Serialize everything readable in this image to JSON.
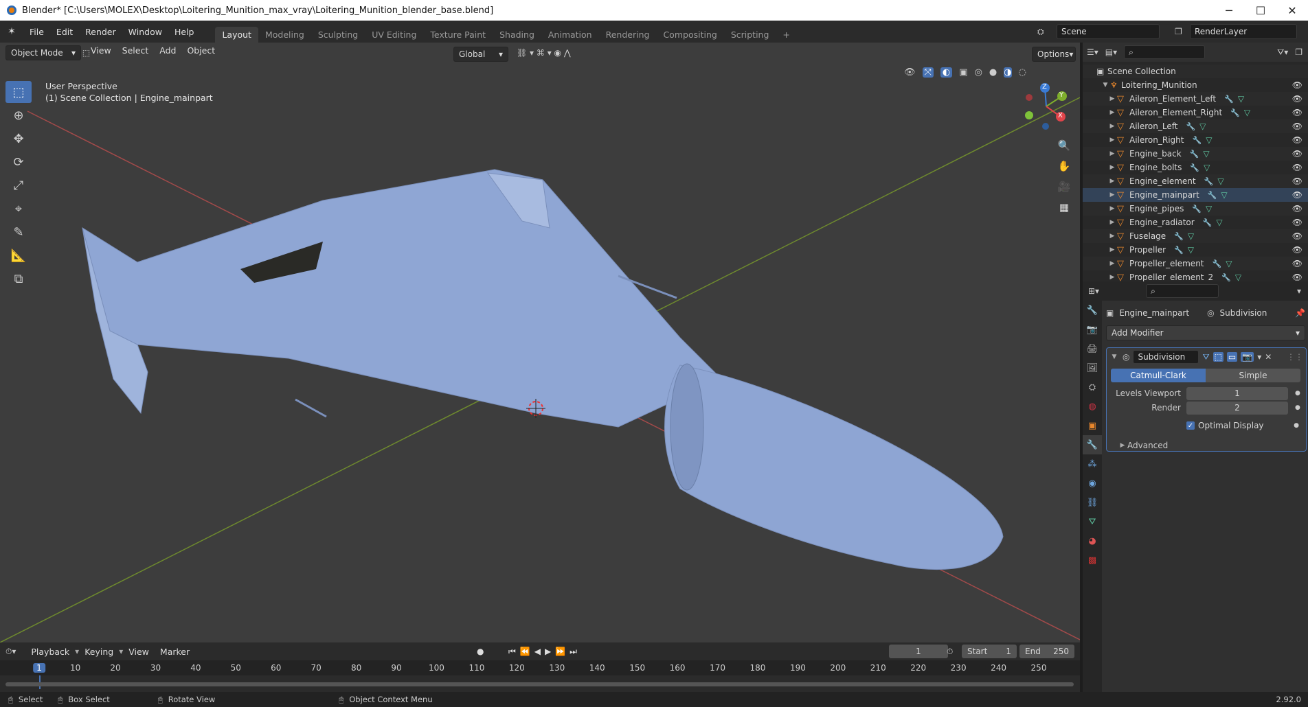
{
  "window": {
    "title": "Blender* [C:\\Users\\MOLEX\\Desktop\\Loitering_Munition_max_vray\\Loitering_Munition_blender_base.blend]",
    "minimize": "─",
    "maximize": "☐",
    "close": "✕"
  },
  "menus": [
    "File",
    "Edit",
    "Render",
    "Window",
    "Help"
  ],
  "workspaces": [
    "Layout",
    "Modeling",
    "Sculpting",
    "UV Editing",
    "Texture Paint",
    "Shading",
    "Animation",
    "Rendering",
    "Compositing",
    "Scripting"
  ],
  "scene": {
    "name": "Scene",
    "view_layer": "RenderLayer"
  },
  "viewport": {
    "mode": "Object Mode",
    "menus": [
      "View",
      "Select",
      "Add",
      "Object"
    ],
    "transform_orientation": "Global",
    "options": "Options",
    "perspective": "User Perspective",
    "collection_info": "(1) Scene Collection | Engine_mainpart",
    "gizmo": {
      "z": "Z",
      "y": "Y",
      "x": "X"
    }
  },
  "outliner": {
    "root": "Scene Collection",
    "collection": "Loitering_Munition",
    "items": [
      "Aileron_Element_Left",
      "Aileron_Element_Right",
      "Aileron_Left",
      "Aileron_Right",
      "Engine_back",
      "Engine_bolts",
      "Engine_element",
      "Engine_mainpart",
      "Engine_pipes",
      "Engine_radiator",
      "Fuselage",
      "Propeller",
      "Propeller_element",
      "Propeller_element_2"
    ]
  },
  "properties": {
    "object": "Engine_mainpart",
    "modifier_label": "Subdivision",
    "add_modifier": "Add Modifier",
    "modifier": {
      "name": "Subdivision",
      "type_a": "Catmull-Clark",
      "type_b": "Simple",
      "levels_viewport_label": "Levels Viewport",
      "levels_viewport": "1",
      "render_label": "Render",
      "render": "2",
      "optimal_display": "Optimal Display",
      "advanced": "Advanced"
    }
  },
  "timeline": {
    "menus": [
      "Playback",
      "Keying",
      "View",
      "Marker"
    ],
    "current_frame": "1",
    "start_label": "Start",
    "start": "1",
    "end_label": "End",
    "end": "250",
    "ticks": [
      "1",
      "10",
      "20",
      "30",
      "40",
      "50",
      "60",
      "70",
      "80",
      "90",
      "100",
      "110",
      "120",
      "130",
      "140",
      "150",
      "160",
      "170",
      "180",
      "190",
      "200",
      "210",
      "220",
      "230",
      "240",
      "250"
    ]
  },
  "status": {
    "select": "Select",
    "box_select": "Box Select",
    "rotate": "Rotate View",
    "context": "Object Context Menu",
    "version": "2.92.0"
  }
}
